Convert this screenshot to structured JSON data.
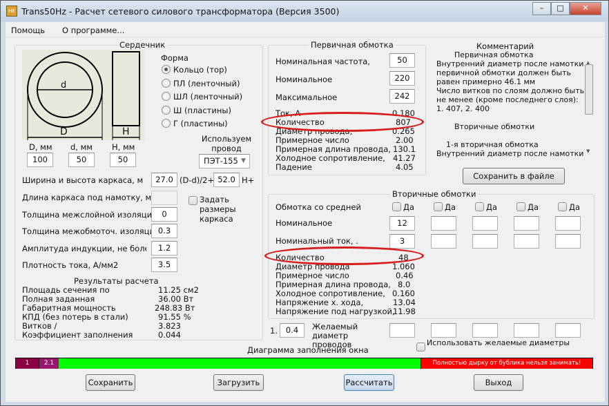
{
  "window": {
    "title": "Trans50Hz - Расчет сетевого силового трансформатора (Версия 3500)",
    "app_icon_text": "НЕ"
  },
  "menu": [
    "Помощь",
    "О программе..."
  ],
  "core": {
    "title": "Сердечник",
    "diagram_labels": {
      "d": "d",
      "D": "D",
      "H": "H"
    },
    "dims": [
      {
        "label": "D, мм",
        "value": "100"
      },
      {
        "label": "d, мм",
        "value": "50"
      },
      {
        "label": "H, мм",
        "value": "50"
      }
    ],
    "shape_label": "Форма",
    "shapes": [
      {
        "label": "Кольцо  (тор)",
        "selected": true
      },
      {
        "label": "ПЛ  (ленточный)",
        "selected": false
      },
      {
        "label": "ШЛ  (ленточный)",
        "selected": false
      },
      {
        "label": "Ш  (пластины)",
        "selected": false
      },
      {
        "label": "Г (пластины)",
        "selected": false
      }
    ],
    "wire_label": "Используем провод",
    "wire_value": "ПЭТ-155",
    "frame_wh_label": "Ширина и высота каркаса, м",
    "frame_w": "27.0",
    "frame_w_suffix": "(D-d)/2+",
    "frame_h": "52.0",
    "frame_h_suffix": "H+",
    "frame_len_label": "Длина каркаса под намотку, м",
    "set_frame_label": "Задать размеры каркаса",
    "params": [
      {
        "label": "Толщина межслойной изоляции,",
        "value": "0"
      },
      {
        "label": "Толщина межобмоточ. изоляции,",
        "value": "0.3"
      },
      {
        "label": "Амплитуда индукции, не более, Тл",
        "value": "1.2"
      },
      {
        "label": "Плотность тока, А/мм2",
        "value": "3.5"
      }
    ],
    "results_title": "Результаты расчета",
    "results": [
      {
        "label": "Площадь сечения по",
        "value": "11.25 см2"
      },
      {
        "label": "Полная заданная",
        "value": "36.00 Вт"
      },
      {
        "label": "Габаритная мощность",
        "value": "248.83 Вт"
      },
      {
        "label": "КПД (без потерь в стали)",
        "value": "91.55 %"
      },
      {
        "label": "Витков /",
        "value": "3.823"
      },
      {
        "label": "Коэффициент заполнения окна",
        "value": "0.044"
      }
    ]
  },
  "primary": {
    "title": "Первичная обмотка",
    "inputs": [
      {
        "label": "Номинальная частота,",
        "value": "50"
      },
      {
        "label": "Номинальное",
        "value": "220"
      },
      {
        "label": "Максимальное",
        "value": "242"
      }
    ],
    "results": [
      {
        "label": "Ток, А",
        "value": "0.180"
      },
      {
        "label": "Количество",
        "value": "807"
      },
      {
        "label": "Диаметр провода,",
        "value": "0.265"
      },
      {
        "label": "Примерное число",
        "value": "2.00"
      },
      {
        "label": "Примерная длина провода,",
        "value": "130.1"
      },
      {
        "label": "Холодное сопротивление,",
        "value": "41.27"
      },
      {
        "label": "Падение",
        "value": "4.05"
      }
    ]
  },
  "comment": {
    "title": "Комментарий",
    "lines": [
      "Первичная обмотка",
      "Внутренний диаметр после намотки",
      "первичной обмотки должен быть",
      "равен примерно 46.1 мм",
      "Число витков по слоям должно быть",
      "не менее (кроме последнего слоя):",
      "1. 407,  2. 400",
      "",
      "Вторичные обмотки",
      "",
      "1-я вторичная обмотка",
      "Внутренний диаметр после намотки"
    ],
    "save_button": "Сохранить в файле"
  },
  "secondary": {
    "title": "Вторичные обмотки",
    "tap_label": "Обмотка со средней",
    "tap_option": "Да",
    "voltage_label": "Номинальное",
    "current_label": "Номинальный ток, .",
    "voltages": [
      "12",
      "",
      "",
      "",
      ""
    ],
    "currents": [
      "3",
      "",
      "",
      "",
      ""
    ],
    "results": [
      {
        "label": "Количество",
        "value": "48"
      },
      {
        "label": "Диаметр провода",
        "value": "1.060"
      },
      {
        "label": "Примерное число",
        "value": "0.46"
      },
      {
        "label": "Примерная длина провода,",
        "value": "8.0"
      },
      {
        "label": "Холодное сопротивление,",
        "value": "0.160"
      },
      {
        "label": "Напряжение х. хода,",
        "value": "13.04"
      },
      {
        "label": "Напряжение под нагрузкой,",
        "value": "11.98"
      }
    ]
  },
  "desired": {
    "index": "1.",
    "primary_value": "0.4",
    "label": "Желаемый диаметр проводов",
    "use_label": "Использовать желаемые диаметры"
  },
  "fill_diagram": {
    "title": "Диаграмма заполнения окна",
    "segments": [
      {
        "label": "1",
        "color": "#8b0045"
      },
      {
        "label": "2.1",
        "color": "#99166e"
      },
      {
        "label": "",
        "color": "#00ff00"
      }
    ],
    "warning": "Полностью дырку от бублика нельзя занимать!",
    "warning_color": "#ff0000"
  },
  "buttons": {
    "save": "Сохранить",
    "load": "Загрузить",
    "calc": "Рассчитать",
    "exit": "Выход"
  }
}
